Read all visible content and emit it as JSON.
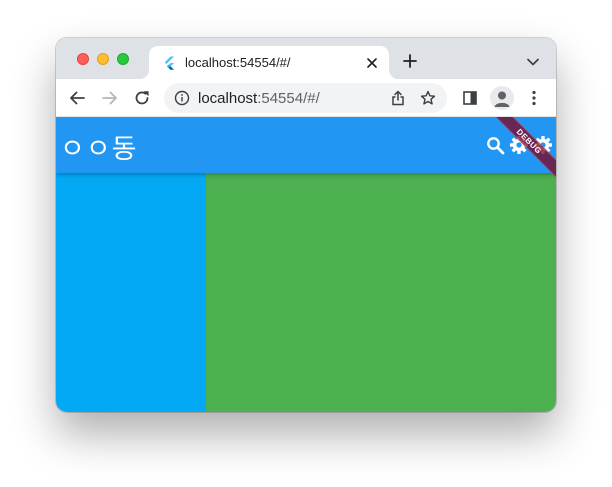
{
  "browser": {
    "tab": {
      "title": "localhost:54554/#/",
      "favicon": "flutter-icon"
    },
    "toolbar": {
      "url_host": "localhost",
      "url_rest": ":54554/#/",
      "icons": [
        "back-arrow-icon",
        "forward-arrow-icon",
        "reload-icon",
        "info-icon",
        "share-icon",
        "star-icon",
        "side-panel-icon",
        "profile-icon",
        "more-vert-icon"
      ]
    },
    "colors": {
      "tabstrip": "#dee1e6",
      "omnibox": "#f1f3f4"
    }
  },
  "app": {
    "appbar": {
      "title": "ㅇㅇ동",
      "actions": [
        "search-icon",
        "settings-icon",
        "settings-icon"
      ],
      "color": "#2196f3"
    },
    "panels": {
      "left_color": "#03a9f4",
      "right_color": "#4caf50"
    },
    "debug_banner": "DEBUG"
  }
}
